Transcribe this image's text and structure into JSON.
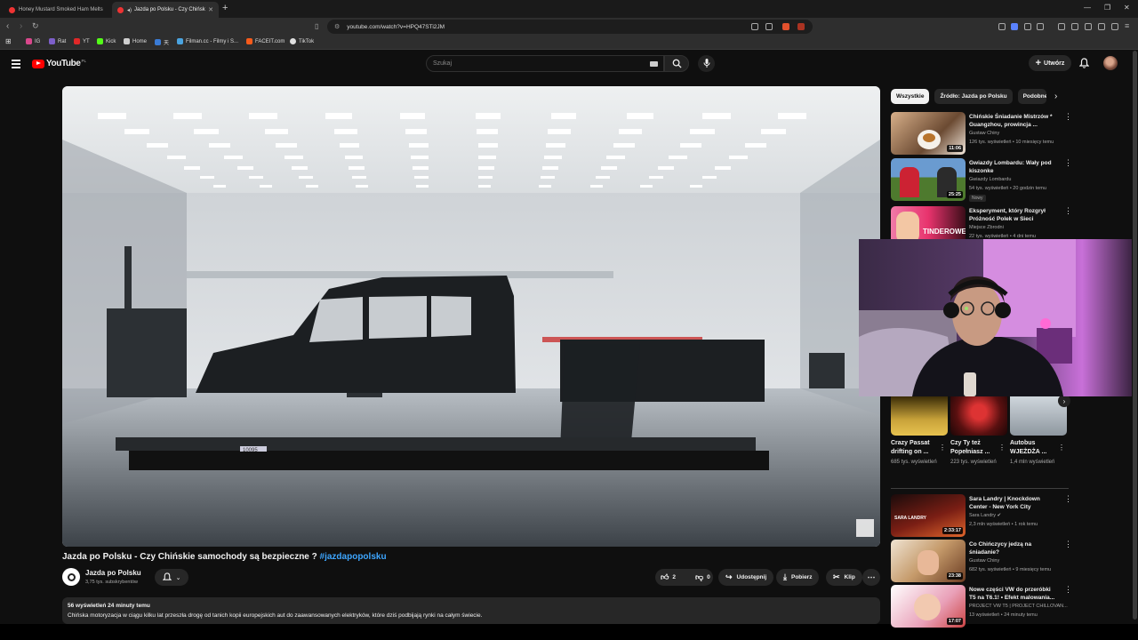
{
  "browser": {
    "tabs": [
      {
        "title": "Honey Mustard Smoked Ham Melts",
        "active": false
      },
      {
        "title": "Jazda po Polsku - Czy Chińsk",
        "active": true
      }
    ],
    "new_tab": "+",
    "window_controls": [
      "—",
      "❐",
      "✕"
    ],
    "url": "youtube.com/watch?v=HPQ47STi2JM",
    "bookmarks": [
      "IG",
      "Rat",
      "YT",
      "Kick",
      "Home",
      "天",
      "Filman.cc - Filmy i S...",
      "FACEIT.com",
      "TikTok"
    ],
    "bookmark_colors": [
      "#d9478c",
      "#7d5fc9",
      "#e02828",
      "#53fc18",
      "#cfcfcf",
      "#3a7bd5",
      "#4aa3df",
      "#f65b1b",
      "#e0e0e0"
    ]
  },
  "youtube": {
    "logo_text": "YouTube",
    "region": "PL",
    "search_placeholder": "Szukaj",
    "create_label": "Utwórz"
  },
  "video": {
    "title": "Jazda po Polsku - Czy Chińskie samochody są bezpieczne ?",
    "hashtag": "#jazdapopolsku",
    "channel": "Jazda po Polsku",
    "subscribers": "3,75 tys. subskrybentów",
    "likes": "2",
    "dislikes": "0",
    "share_label": "Udostępnij",
    "download_label": "Pobierz",
    "clip_label": "Klip",
    "stats": "56 wyświetleń  24 minuty temu",
    "description": "Chińska motoryzacja w ciągu kilku lat przeszła drogę od tanich kopii europejskich aut do zaawansowanych elektryków, które dziś podbijają rynki na całym świecie.",
    "frame_plate": "10095"
  },
  "sidebar": {
    "chips": [
      "Wszystkie",
      "Źródło: Jazda po Polsku",
      "Podobne"
    ],
    "recommendations_top": [
      {
        "title": "Chińskie Śniadanie Mistrzów * Guangzhou, prowincja ...",
        "channel": "Gustaw Chiny",
        "meta": "126 tys. wyświetleń • 10 miesięcy temu",
        "duration": "11:06",
        "badge": ""
      },
      {
        "title": "Gwiazdy Lombardu: Wały pod kiszonke",
        "channel": "Gwiazdy Lombardu",
        "meta": "54 tys. wyświetleń • 20 godzin temu",
        "duration": "25:25",
        "badge": "Nowy"
      },
      {
        "title": "Eksperyment, który Rozgrył Próżność Polek w Sieci",
        "channel": "Miejsce Zbrodni",
        "meta": "22 tys. wyświetleń • 4 dni temu",
        "duration": "",
        "badge": "",
        "thumb_text": "TINDEROWE"
      }
    ],
    "shorts": [
      {
        "title": "Crazy Passat drifting on ...",
        "views": "685 tys. wyświetleń"
      },
      {
        "title": "Czy Ty też Popełniasz ...",
        "views": "223 tys. wyświetleń"
      },
      {
        "title": "Autobus WJEŻDŻA ...",
        "views": "1,4 mln wyświetleń"
      }
    ],
    "recommendations_bottom": [
      {
        "title": "Sara Landry | Knockdown Center - New York City",
        "channel": "Sara Landry",
        "meta": "2,3 mln wyświetleń • 1 rok temu",
        "duration": "2:33:17",
        "thumb_text": "SARA LANDRY"
      },
      {
        "title": "Co Chińczycy jedzą na śniadanie?",
        "channel": "Gustaw Chiny",
        "meta": "682 tys. wyświetleń • 9 miesięcy temu",
        "duration": "23:38"
      },
      {
        "title": "Nowe części VW do przeróbki T5 na T6.1! • Efekt malowania...",
        "channel": "PROJECT VW T5 | PROJECT CHILLOVAN...",
        "meta": "13 wyświetleń • 24 minuty temu",
        "duration": "17:07"
      }
    ]
  }
}
